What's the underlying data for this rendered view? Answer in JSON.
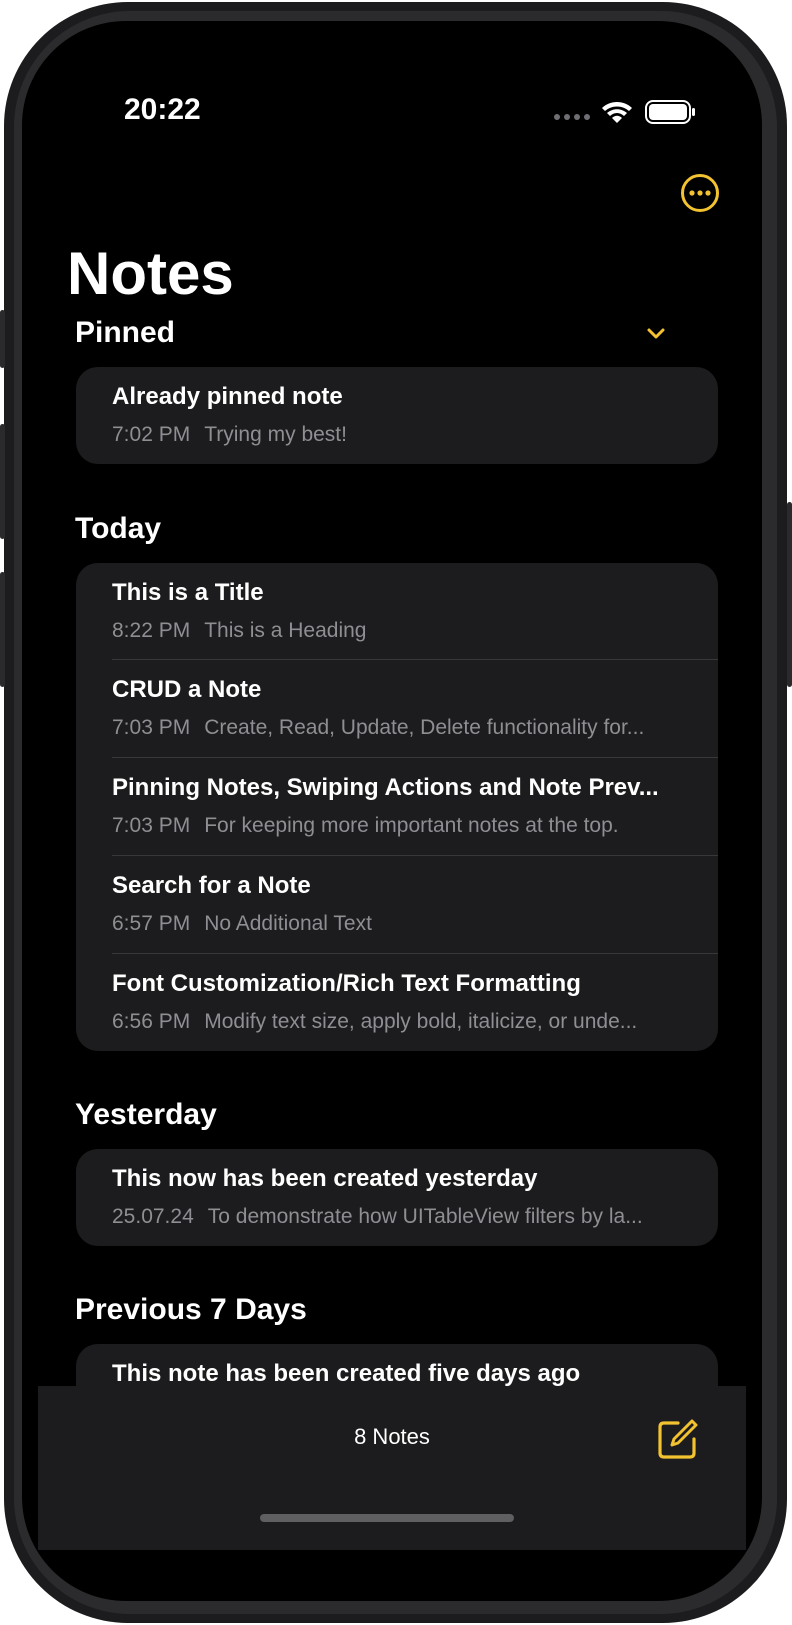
{
  "status": {
    "time": "20:22"
  },
  "colors": {
    "accent": "#f2c230",
    "background": "#000000",
    "card": "#1c1c1e",
    "secondary_text": "#8e8e93"
  },
  "header": {
    "title": "Notes",
    "more_icon": "ellipsis-circle-icon"
  },
  "sections": {
    "pinned": {
      "title": "Pinned",
      "collapse_icon": "chevron-down-icon",
      "notes": [
        {
          "title": "Already pinned note",
          "time": "7:02 PM",
          "preview": "Trying my best!"
        }
      ]
    },
    "today": {
      "title": "Today",
      "notes": [
        {
          "title": "This is a Title",
          "time": "8:22 PM",
          "preview": "This is a Heading"
        },
        {
          "title": "CRUD a Note",
          "time": "7:03 PM",
          "preview": "Create, Read, Update, Delete functionality for..."
        },
        {
          "title": "Pinning Notes, Swiping Actions and Note Prev...",
          "time": "7:03 PM",
          "preview": "For keeping more important notes at the top."
        },
        {
          "title": "Search for a Note",
          "time": "6:57 PM",
          "preview": "No Additional Text"
        },
        {
          "title": "Font Customization/Rich Text Formatting",
          "time": "6:56 PM",
          "preview": "Modify text size, apply bold, italicize, or unde..."
        }
      ]
    },
    "yesterday": {
      "title": "Yesterday",
      "notes": [
        {
          "title": "This now has been created yesterday",
          "time": "25.07.24",
          "preview": "To demonstrate how UITableView filters by la..."
        }
      ]
    },
    "previous7": {
      "title": "Previous 7 Days",
      "notes": [
        {
          "title": "This note has been created five days ago"
        }
      ]
    }
  },
  "toolbar": {
    "note_count": "8 Notes",
    "compose_icon": "compose-icon"
  }
}
